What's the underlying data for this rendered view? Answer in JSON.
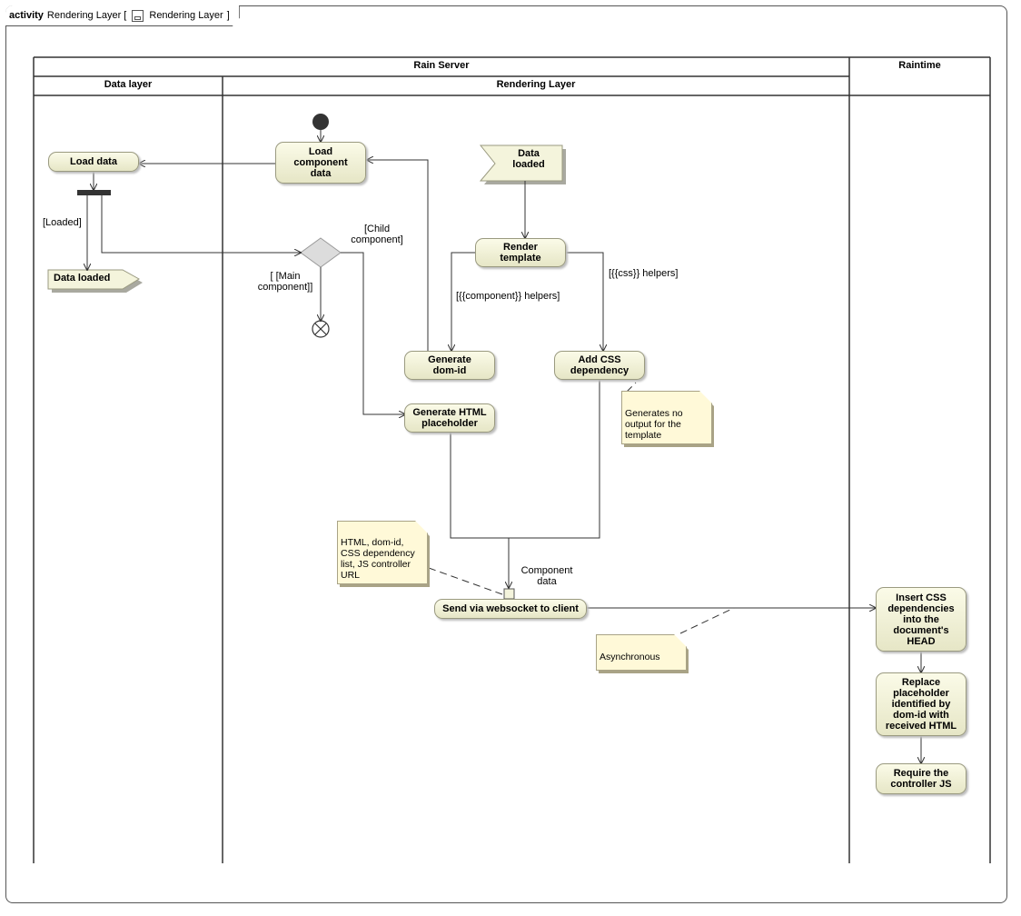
{
  "frame": {
    "keyword": "activity",
    "name": "Rendering Layer [",
    "tab_icon": "activity-diagram-icon",
    "diagram_ref": "Rendering Layer",
    "suffix": "]"
  },
  "partitions": {
    "rain_server": "Rain Server",
    "raintime": "Raintime",
    "data_layer": "Data layer",
    "rendering_layer": "Rendering Layer"
  },
  "actions": {
    "load_component_data": "Load\ncomponent\ndata",
    "load_data": "Load data",
    "render_template": "Render\ntemplate",
    "generate_dom_id": "Generate\ndom-id",
    "add_css_dependency": "Add CSS\ndependency",
    "generate_html_placeholder": "Generate HTML\nplaceholder",
    "send_via_websocket": "Send via websocket to client",
    "insert_css_dependencies": "Insert CSS\ndependencies\ninto the\ndocument's\nHEAD",
    "replace_placeholder": "Replace\nplaceholder\nidentified by\ndom-id with\nreceived HTML",
    "require_controller": "Require the\ncontroller JS"
  },
  "signals": {
    "data_loaded_accept": "Data\nloaded",
    "data_loaded_send": "Data loaded"
  },
  "guards": {
    "loaded": "[Loaded]",
    "child_component": "[Child\ncomponent]",
    "main_component": "[ [Main\ncomponent]]",
    "component_helpers": "[{{component}} helpers]",
    "css_helpers": "[{{css}} helpers]"
  },
  "pins": {
    "component_data": "Component\ndata"
  },
  "notes": {
    "generates_no_output": "Generates no\noutput for the\ntemplate",
    "payload": "HTML, dom-id,\nCSS dependency\nlist, JS controller\nURL",
    "asynchronous": "Asynchronous"
  },
  "colors": {
    "action_fill_top": "#fbfbe8",
    "action_fill_bottom": "#e6e6c6",
    "note_fill": "#fff9d8",
    "line": "#333333"
  }
}
